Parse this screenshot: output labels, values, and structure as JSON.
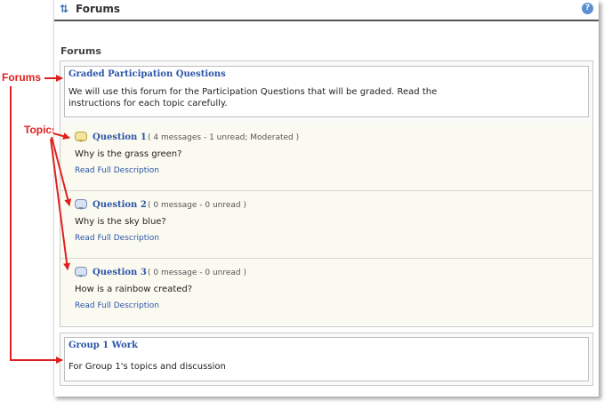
{
  "window": {
    "title": "Forums",
    "refresh_icon": "refresh-icon",
    "help_icon": "help-icon"
  },
  "section_heading": "Forums",
  "forums": [
    {
      "title": "Graded Participation Questions",
      "description": "We will use this forum for the Participation Questions that will be graded. Read the instructions for each topic carefully.",
      "topics": [
        {
          "name": "Question 1",
          "meta": "( 4 messages - 1 unread; Moderated )",
          "text": "Why is the grass green?",
          "link": "Read Full Description",
          "icon": "chat-bubble-unread-icon"
        },
        {
          "name": "Question 2",
          "meta": "( 0 message - 0 unread )",
          "text": "Why is the sky blue?",
          "link": "Read Full Description",
          "icon": "chat-bubble-icon"
        },
        {
          "name": "Question 3",
          "meta": "( 0 message - 0 unread )",
          "text": "How is a rainbow created?",
          "link": "Read Full Description",
          "icon": "chat-bubble-icon"
        }
      ]
    },
    {
      "title": "Group 1 Work",
      "description": "For Group 1's topics and discussion"
    }
  ],
  "annotations": {
    "forums_label": "Forums",
    "topics_label": "Topics",
    "color": "#e02020"
  }
}
